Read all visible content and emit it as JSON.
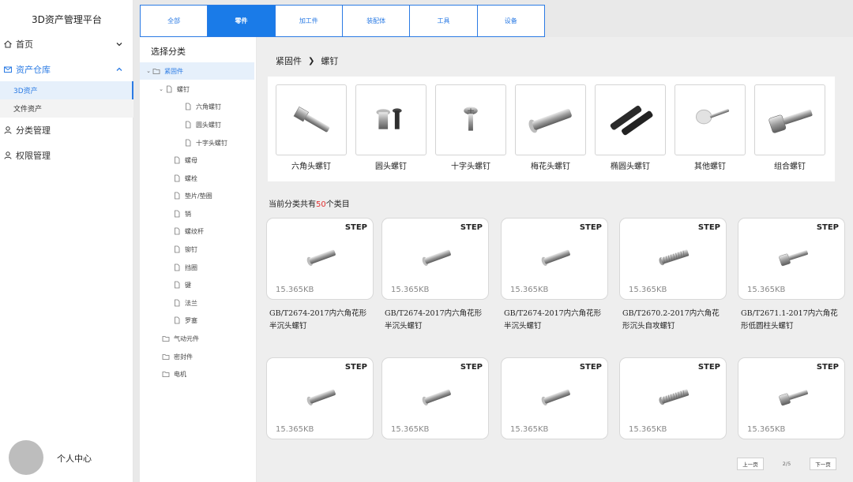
{
  "app_title": "3D资产管理平台",
  "nav": {
    "home": "首页",
    "assets": "资产仓库",
    "sub_3d": "3D资产",
    "sub_files": "文件资产",
    "category": "分类管理",
    "permission": "权限管理",
    "profile": "个人中心"
  },
  "tabs": [
    "全部",
    "零件",
    "加工件",
    "装配体",
    "工具",
    "设备"
  ],
  "tree": {
    "title": "选择分类",
    "nodes": [
      "紧固件",
      "螺钉",
      "六角螺钉",
      "圆头螺钉",
      "十字头螺钉",
      "螺母",
      "螺栓",
      "垫片/垫圈",
      "销",
      "螺纹杆",
      "铆钉",
      "挡圈",
      "键",
      "法兰",
      "罗塞",
      "气动元件",
      "密封件",
      "电机"
    ]
  },
  "breadcrumb": {
    "parent": "紧固件",
    "current": "螺钉"
  },
  "categories": [
    "六角头螺钉",
    "圆头螺钉",
    "十字头螺钉",
    "梅花头螺钉",
    "椭圆头螺钉",
    "其他螺钉",
    "组合螺钉"
  ],
  "count": {
    "prefix": "当前分类共有",
    "number": "50",
    "suffix": "个类目"
  },
  "assets": [
    {
      "format": "STEP",
      "size": "15.365KB",
      "name": "GB/T2674-2017内六角花形半沉头螺钉"
    },
    {
      "format": "STEP",
      "size": "15.365KB",
      "name": "GB/T2674-2017内六角花形半沉头螺钉"
    },
    {
      "format": "STEP",
      "size": "15.365KB",
      "name": "GB/T2674-2017内六角花形半沉头螺钉"
    },
    {
      "format": "STEP",
      "size": "15.365KB",
      "name": "GB/T2670.2-2017内六角花形沉头自攻螺钉"
    },
    {
      "format": "STEP",
      "size": "15.365KB",
      "name": "GB/T2671.1-2017内六角花形低圆柱头螺钉"
    },
    {
      "format": "STEP",
      "size": "15.365KB",
      "name": ""
    },
    {
      "format": "STEP",
      "size": "15.365KB",
      "name": ""
    },
    {
      "format": "STEP",
      "size": "15.365KB",
      "name": ""
    },
    {
      "format": "STEP",
      "size": "15.365KB",
      "name": ""
    },
    {
      "format": "STEP",
      "size": "15.365KB",
      "name": ""
    }
  ],
  "pager": {
    "prev": "上一页",
    "info": "2/5",
    "next": "下一页"
  },
  "colors": {
    "accent": "#1a7be8",
    "highlight_number": "#e03131"
  }
}
